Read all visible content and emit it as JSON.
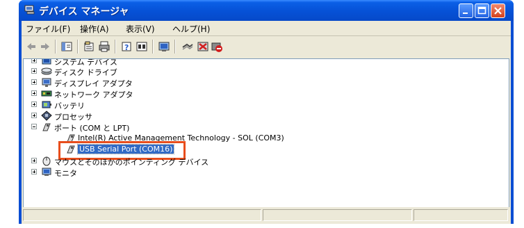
{
  "window": {
    "title": "デバイス マネージャ",
    "accent_color": "#0a4ed3"
  },
  "menu": {
    "items": [
      "ファイル(F)",
      "操作(A)",
      "表示(V)",
      "ヘルプ(H)"
    ]
  },
  "toolbar": {
    "icons": [
      "back-arrow-icon",
      "forward-arrow-icon",
      "console-tree-icon",
      "properties-icon",
      "print-icon",
      "help-icon",
      "view-icon",
      "scan-hardware-icon",
      "update-driver-icon",
      "uninstall-icon",
      "disable-icon"
    ]
  },
  "tree": {
    "items": [
      {
        "label": "システム デバイス",
        "icon": "system-devices-icon",
        "expanded": false
      },
      {
        "label": "ディスク ドライブ",
        "icon": "disk-drive-icon",
        "expanded": false
      },
      {
        "label": "ディスプレイ アダプタ",
        "icon": "display-adapter-icon",
        "expanded": false
      },
      {
        "label": "ネットワーク アダプタ",
        "icon": "network-adapter-icon",
        "expanded": false
      },
      {
        "label": "バッテリ",
        "icon": "battery-icon",
        "expanded": false
      },
      {
        "label": "プロセッサ",
        "icon": "processor-icon",
        "expanded": false
      },
      {
        "label": "ポート (COM と LPT)",
        "icon": "port-icon",
        "expanded": true
      },
      {
        "label": "Intel(R) Active Management Technology - SOL (COM3)",
        "icon": "port-icon",
        "child": true
      },
      {
        "label": "USB Serial Port (COM16)",
        "icon": "port-icon",
        "child": true,
        "selected": true
      },
      {
        "label": "マウスとそのほかのポインティング デバイス",
        "icon": "mouse-icon",
        "expanded": false
      },
      {
        "label": "モニタ",
        "icon": "monitor-icon",
        "expanded": false
      }
    ]
  },
  "highlight_color": "#e84d1c"
}
